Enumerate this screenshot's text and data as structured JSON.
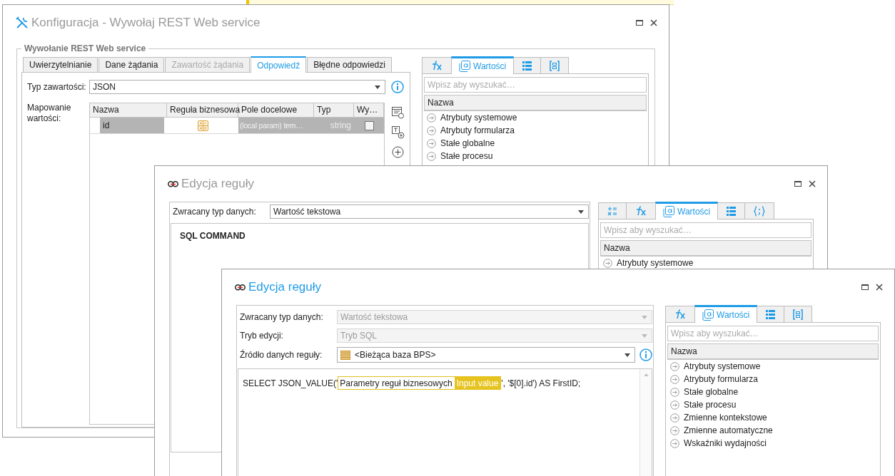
{
  "config_window": {
    "title": "Konfiguracja - Wywołaj REST Web service",
    "active": false,
    "group_title": "Wywołanie REST Web service",
    "tabs": [
      {
        "label": "Uwierzytelnianie",
        "selected": false,
        "disabled": false
      },
      {
        "label": "Dane żądania",
        "selected": false,
        "disabled": false
      },
      {
        "label": "Zawartość żądania",
        "selected": false,
        "disabled": true
      },
      {
        "label": "Odpowiedź",
        "selected": true,
        "disabled": false
      },
      {
        "label": "Błędne odpowiedzi",
        "selected": false,
        "disabled": false
      }
    ],
    "content_type": {
      "label": "Typ zawartości:",
      "value": "JSON"
    },
    "mapping": {
      "label": "Mapowanie wartości:",
      "columns": [
        "Nazwa",
        "Reguła biznesowa",
        "Pole docelowe",
        "Typ",
        "Wy…"
      ],
      "rows": [
        {
          "name": "id",
          "target": "(local param) tem…",
          "type": "string",
          "checked": false,
          "selected": true
        }
      ]
    },
    "side_panel": {
      "tabs": [
        {
          "kind": "fx",
          "selected": false
        },
        {
          "kind": "values",
          "label": "Wartości",
          "selected": true
        },
        {
          "kind": "list",
          "selected": false
        },
        {
          "kind": "brackets",
          "selected": false
        }
      ],
      "search_placeholder": "Wpisz aby wyszukać…",
      "header": "Nazwa",
      "items": [
        "Atrybuty systemowe",
        "Atrybuty formularza",
        "Stałe globalne",
        "Stałe procesu"
      ]
    }
  },
  "rule_window_back": {
    "title": "Edycja reguły",
    "active": false,
    "fields": [
      {
        "kind": "select",
        "label": "Zwracany typ danych:",
        "value": "Wartość tekstowa",
        "disabled": false
      }
    ],
    "command_title": "SQL COMMAND",
    "side_panel": {
      "tabs": [
        {
          "kind": "formula",
          "selected": false
        },
        {
          "kind": "fx",
          "selected": false
        },
        {
          "kind": "values",
          "label": "Wartości",
          "selected": true
        },
        {
          "kind": "list",
          "selected": false
        },
        {
          "kind": "code",
          "selected": false
        }
      ],
      "search_placeholder": "Wpisz aby wyszukać…",
      "header": "Nazwa",
      "items": [
        "Atrybuty systemowe"
      ]
    }
  },
  "rule_window_front": {
    "title": "Edycja reguły",
    "active": true,
    "fields": [
      {
        "kind": "select",
        "label": "Zwracany typ danych:",
        "value": "Wartość tekstowa",
        "disabled": true
      },
      {
        "kind": "select",
        "label": "Tryb edycji:",
        "value": "Tryb SQL",
        "disabled": true
      },
      {
        "kind": "source",
        "label": "Źródło danych reguły:",
        "value": "<Bieżąca baza BPS>",
        "disabled": false
      }
    ],
    "code": [
      {
        "kind": "text",
        "text": "SELECT JSON_VALUE('"
      },
      {
        "kind": "token",
        "group": "Parametry reguł biznesowych",
        "value": "Input value"
      },
      {
        "kind": "text",
        "text": "', '$[0].id') AS FirstID;"
      }
    ],
    "side_panel": {
      "tabs": [
        {
          "kind": "fx",
          "selected": false
        },
        {
          "kind": "values",
          "label": "Wartości",
          "selected": true
        },
        {
          "kind": "list",
          "selected": false
        },
        {
          "kind": "brackets",
          "selected": false
        }
      ],
      "search_placeholder": "Wpisz aby wyszukać…",
      "header": "Nazwa",
      "items": [
        "Atrybuty systemowe",
        "Atrybuty formularza",
        "Stałe globalne",
        "Stałe procesu",
        "Zmienne kontekstowe",
        "Zmienne automatyczne",
        "Wskaźniki wydajności"
      ]
    }
  }
}
